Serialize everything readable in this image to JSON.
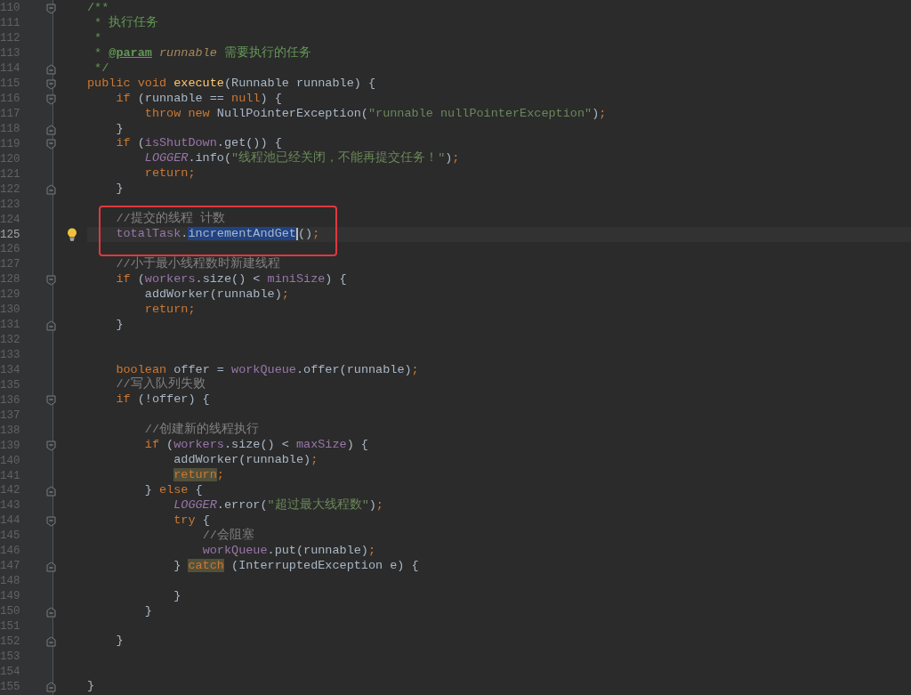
{
  "editor": {
    "lines": [
      {
        "number": "110",
        "current": false,
        "lightbulb": false,
        "boxed": false,
        "kind": "fold-start",
        "tokens": [
          {
            "kind": "doc",
            "text": "/**"
          }
        ]
      },
      {
        "number": "111",
        "current": false,
        "lightbulb": false,
        "boxed": false,
        "kind": "plain",
        "tokens": [
          {
            "kind": "doc",
            "text": " * 执行任务"
          }
        ]
      },
      {
        "number": "112",
        "current": false,
        "lightbulb": false,
        "boxed": false,
        "kind": "plain",
        "tokens": [
          {
            "kind": "doc",
            "text": " *"
          }
        ]
      },
      {
        "number": "113",
        "current": false,
        "lightbulb": false,
        "boxed": false,
        "kind": "plain",
        "tokens": [
          {
            "kind": "doc",
            "text": " * "
          },
          {
            "kind": "doctag",
            "text": "@param"
          },
          {
            "kind": "docparam",
            "text": " runnable"
          },
          {
            "kind": "doc",
            "text": " 需要执行的任务"
          }
        ]
      },
      {
        "number": "114",
        "current": false,
        "lightbulb": false,
        "boxed": false,
        "kind": "fold-end",
        "tokens": [
          {
            "kind": "doc",
            "text": " */"
          }
        ]
      },
      {
        "number": "115",
        "current": false,
        "lightbulb": false,
        "boxed": false,
        "kind": "fold-start",
        "tokens": [
          {
            "kind": "keyword",
            "text": "public void "
          },
          {
            "kind": "method",
            "text": "execute"
          },
          {
            "kind": "plain",
            "text": "(Runnable runnable) {"
          }
        ]
      },
      {
        "number": "116",
        "current": false,
        "lightbulb": false,
        "boxed": false,
        "kind": "fold-start",
        "tokens": [
          {
            "kind": "keyword",
            "text": "    if"
          },
          {
            "kind": "plain",
            "text": " (runnable == "
          },
          {
            "kind": "keyword",
            "text": "null"
          },
          {
            "kind": "plain",
            "text": ") {"
          }
        ]
      },
      {
        "number": "117",
        "current": false,
        "lightbulb": false,
        "boxed": false,
        "kind": "plain",
        "tokens": [
          {
            "kind": "keyword",
            "text": "        throw new "
          },
          {
            "kind": "plain",
            "text": "NullPointerException("
          },
          {
            "kind": "string",
            "text": "\"runnable nullPointerException\""
          },
          {
            "kind": "plain",
            "text": ")"
          },
          {
            "kind": "punct",
            "text": ";"
          }
        ]
      },
      {
        "number": "118",
        "current": false,
        "lightbulb": false,
        "boxed": false,
        "kind": "fold-end",
        "tokens": [
          {
            "kind": "plain",
            "text": "    }"
          }
        ]
      },
      {
        "number": "119",
        "current": false,
        "lightbulb": false,
        "boxed": false,
        "kind": "fold-start",
        "tokens": [
          {
            "kind": "keyword",
            "text": "    if"
          },
          {
            "kind": "plain",
            "text": " ("
          },
          {
            "kind": "field",
            "text": "isShutDown"
          },
          {
            "kind": "plain",
            "text": ".get()) {"
          }
        ]
      },
      {
        "number": "120",
        "current": false,
        "lightbulb": false,
        "boxed": false,
        "kind": "plain",
        "tokens": [
          {
            "kind": "static",
            "text": "        LOGGER"
          },
          {
            "kind": "plain",
            "text": ".info("
          },
          {
            "kind": "string",
            "text": "\"线程池已经关闭，不能再提交任务！\""
          },
          {
            "kind": "plain",
            "text": ")"
          },
          {
            "kind": "punct",
            "text": ";"
          }
        ]
      },
      {
        "number": "121",
        "current": false,
        "lightbulb": false,
        "boxed": false,
        "kind": "plain",
        "tokens": [
          {
            "kind": "keyword",
            "text": "        return;"
          }
        ]
      },
      {
        "number": "122",
        "current": false,
        "lightbulb": false,
        "boxed": false,
        "kind": "fold-end",
        "tokens": [
          {
            "kind": "plain",
            "text": "    }"
          }
        ]
      },
      {
        "number": "123",
        "current": false,
        "lightbulb": false,
        "boxed": false,
        "kind": "plain"
      },
      {
        "number": "124",
        "current": false,
        "lightbulb": false,
        "boxed": true,
        "kind": "plain",
        "tokens": [
          {
            "kind": "comment",
            "text": "    //提交的线程 计数"
          }
        ]
      },
      {
        "number": "125",
        "current": true,
        "lightbulb": true,
        "boxed": true,
        "kind": "plain",
        "tokens": [
          {
            "kind": "field",
            "text": "    totalTask"
          },
          {
            "kind": "plain",
            "text": "."
          },
          {
            "kind": "selected",
            "text": "incrementAndGet"
          },
          {
            "kind": "plain",
            "text": "()"
          },
          {
            "kind": "punct",
            "text": ";"
          }
        ]
      },
      {
        "number": "126",
        "current": false,
        "lightbulb": false,
        "boxed": false,
        "kind": "plain"
      },
      {
        "number": "127",
        "current": false,
        "lightbulb": false,
        "boxed": false,
        "kind": "plain",
        "tokens": [
          {
            "kind": "comment",
            "text": "    //小于最小线程数时新建线程"
          }
        ]
      },
      {
        "number": "128",
        "current": false,
        "lightbulb": false,
        "boxed": false,
        "kind": "fold-start",
        "tokens": [
          {
            "kind": "keyword",
            "text": "    if"
          },
          {
            "kind": "plain",
            "text": " ("
          },
          {
            "kind": "field",
            "text": "workers"
          },
          {
            "kind": "plain",
            "text": ".size() < "
          },
          {
            "kind": "field",
            "text": "miniSize"
          },
          {
            "kind": "plain",
            "text": ") {"
          }
        ]
      },
      {
        "number": "129",
        "current": false,
        "lightbulb": false,
        "boxed": false,
        "kind": "plain",
        "tokens": [
          {
            "kind": "plain",
            "text": "        addWorker(runnable)"
          },
          {
            "kind": "punct",
            "text": ";"
          }
        ]
      },
      {
        "number": "130",
        "current": false,
        "lightbulb": false,
        "boxed": false,
        "kind": "plain",
        "tokens": [
          {
            "kind": "keyword",
            "text": "        return;"
          }
        ]
      },
      {
        "number": "131",
        "current": false,
        "lightbulb": false,
        "boxed": false,
        "kind": "fold-end",
        "tokens": [
          {
            "kind": "plain",
            "text": "    }"
          }
        ]
      },
      {
        "number": "132",
        "current": false,
        "lightbulb": false,
        "boxed": false,
        "kind": "plain"
      },
      {
        "number": "133",
        "current": false,
        "lightbulb": false,
        "boxed": false,
        "kind": "plain"
      },
      {
        "number": "134",
        "current": false,
        "lightbulb": false,
        "boxed": false,
        "kind": "plain",
        "tokens": [
          {
            "kind": "keyword",
            "text": "    boolean"
          },
          {
            "kind": "plain",
            "text": " offer = "
          },
          {
            "kind": "field",
            "text": "workQueue"
          },
          {
            "kind": "plain",
            "text": ".offer(runnable)"
          },
          {
            "kind": "punct",
            "text": ";"
          }
        ]
      },
      {
        "number": "135",
        "current": false,
        "lightbulb": false,
        "boxed": false,
        "kind": "plain",
        "tokens": [
          {
            "kind": "comment",
            "text": "    //写入队列失败"
          }
        ]
      },
      {
        "number": "136",
        "current": false,
        "lightbulb": false,
        "boxed": false,
        "kind": "fold-start",
        "tokens": [
          {
            "kind": "keyword",
            "text": "    if"
          },
          {
            "kind": "plain",
            "text": " (!offer) {"
          }
        ]
      },
      {
        "number": "137",
        "current": false,
        "lightbulb": false,
        "boxed": false,
        "kind": "plain"
      },
      {
        "number": "138",
        "current": false,
        "lightbulb": false,
        "boxed": false,
        "kind": "plain",
        "tokens": [
          {
            "kind": "comment",
            "text": "        //创建新的线程执行"
          }
        ]
      },
      {
        "number": "139",
        "current": false,
        "lightbulb": false,
        "boxed": false,
        "kind": "fold-start",
        "tokens": [
          {
            "kind": "keyword",
            "text": "        if"
          },
          {
            "kind": "plain",
            "text": " ("
          },
          {
            "kind": "field",
            "text": "workers"
          },
          {
            "kind": "plain",
            "text": ".size() < "
          },
          {
            "kind": "field",
            "text": "maxSize"
          },
          {
            "kind": "plain",
            "text": ") {"
          }
        ]
      },
      {
        "number": "140",
        "current": false,
        "lightbulb": false,
        "boxed": false,
        "kind": "plain",
        "tokens": [
          {
            "kind": "plain",
            "text": "            addWorker(runnable)"
          },
          {
            "kind": "punct",
            "text": ";"
          }
        ]
      },
      {
        "number": "141",
        "current": false,
        "lightbulb": false,
        "boxed": false,
        "kind": "plain",
        "tokens": [
          {
            "kind": "keyword-highlighted",
            "text": "            return"
          },
          {
            "kind": "punct",
            "text": ";"
          }
        ]
      },
      {
        "number": "142",
        "current": false,
        "lightbulb": false,
        "boxed": false,
        "kind": "fold-end",
        "tokens": [
          {
            "kind": "plain",
            "text": "        } "
          },
          {
            "kind": "keyword",
            "text": "else"
          },
          {
            "kind": "plain",
            "text": " {"
          }
        ]
      },
      {
        "number": "143",
        "current": false,
        "lightbulb": false,
        "boxed": false,
        "kind": "plain",
        "tokens": [
          {
            "kind": "static",
            "text": "            LOGGER"
          },
          {
            "kind": "plain",
            "text": ".error("
          },
          {
            "kind": "string",
            "text": "\"超过最大线程数\""
          },
          {
            "kind": "plain",
            "text": ")"
          },
          {
            "kind": "punct",
            "text": ";"
          }
        ]
      },
      {
        "number": "144",
        "current": false,
        "lightbulb": false,
        "boxed": false,
        "kind": "fold-start",
        "tokens": [
          {
            "kind": "keyword",
            "text": "            try"
          },
          {
            "kind": "plain",
            "text": " {"
          }
        ]
      },
      {
        "number": "145",
        "current": false,
        "lightbulb": false,
        "boxed": false,
        "kind": "plain",
        "tokens": [
          {
            "kind": "comment",
            "text": "                //会阻塞"
          }
        ]
      },
      {
        "number": "146",
        "current": false,
        "lightbulb": false,
        "boxed": false,
        "kind": "plain",
        "tokens": [
          {
            "kind": "field",
            "text": "                workQueue"
          },
          {
            "kind": "plain",
            "text": ".put(runnable)"
          },
          {
            "kind": "punct",
            "text": ";"
          }
        ]
      },
      {
        "number": "147",
        "current": false,
        "lightbulb": false,
        "boxed": false,
        "kind": "fold-end",
        "tokens": [
          {
            "kind": "plain",
            "text": "            } "
          },
          {
            "kind": "keyword-highlighted",
            "text": "catch"
          },
          {
            "kind": "plain",
            "text": " (InterruptedException e) {"
          }
        ]
      },
      {
        "number": "148",
        "current": false,
        "lightbulb": false,
        "boxed": false,
        "kind": "plain"
      },
      {
        "number": "149",
        "current": false,
        "lightbulb": false,
        "boxed": false,
        "kind": "plain",
        "tokens": [
          {
            "kind": "plain",
            "text": "            }"
          }
        ]
      },
      {
        "number": "150",
        "current": false,
        "lightbulb": false,
        "boxed": false,
        "kind": "fold-end",
        "tokens": [
          {
            "kind": "plain",
            "text": "        }"
          }
        ]
      },
      {
        "number": "151",
        "current": false,
        "lightbulb": false,
        "boxed": false,
        "kind": "plain"
      },
      {
        "number": "152",
        "current": false,
        "lightbulb": false,
        "boxed": false,
        "kind": "fold-end",
        "tokens": [
          {
            "kind": "plain",
            "text": "    }"
          }
        ]
      },
      {
        "number": "153",
        "current": false,
        "lightbulb": false,
        "boxed": false,
        "kind": "plain"
      },
      {
        "number": "154",
        "current": false,
        "lightbulb": false,
        "boxed": false,
        "kind": "plain"
      },
      {
        "number": "155",
        "current": false,
        "lightbulb": false,
        "boxed": false,
        "kind": "fold-end",
        "tokens": [
          {
            "kind": "plain",
            "text": "}"
          }
        ]
      }
    ]
  }
}
